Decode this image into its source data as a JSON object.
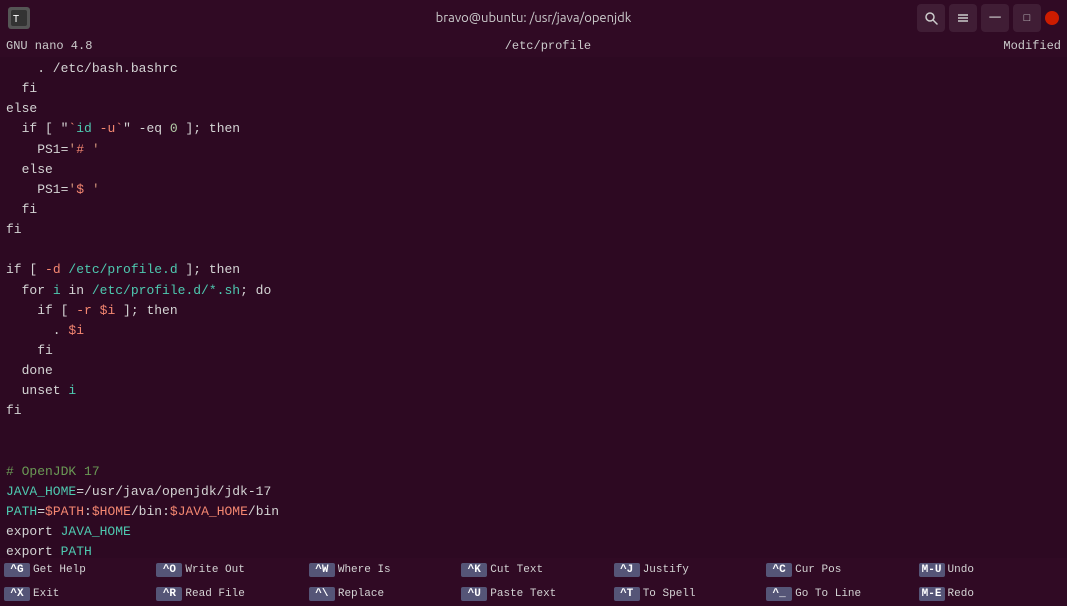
{
  "titlebar": {
    "title": "bravo@ubuntu: /usr/java/openjdk",
    "app_icon": "T"
  },
  "nano": {
    "top_left": "GNU nano 4.8",
    "top_center": "/etc/profile",
    "top_right": "Modified"
  },
  "editor": {
    "lines": [
      {
        "content": "    . /etc/bash.bashrc",
        "type": "mixed"
      },
      {
        "content": "  fi",
        "type": "keyword"
      },
      {
        "content": "else",
        "type": "keyword"
      },
      {
        "content": "  if [ \"`id -u`\" -eq 0 ]; then",
        "type": "mixed"
      },
      {
        "content": "    PS1='# '",
        "type": "mixed"
      },
      {
        "content": "  else",
        "type": "keyword"
      },
      {
        "content": "    PS1='$ '",
        "type": "mixed"
      },
      {
        "content": "  fi",
        "type": "keyword"
      },
      {
        "content": "fi",
        "type": "keyword"
      },
      {
        "content": "",
        "type": "blank"
      },
      {
        "content": "if [ -d /etc/profile.d ]; then",
        "type": "mixed"
      },
      {
        "content": "  for i in /etc/profile.d/*.sh; do",
        "type": "mixed"
      },
      {
        "content": "    if [ -r $i ]; then",
        "type": "mixed"
      },
      {
        "content": "      . $i",
        "type": "mixed"
      },
      {
        "content": "    fi",
        "type": "keyword"
      },
      {
        "content": "  done",
        "type": "keyword"
      },
      {
        "content": "  unset i",
        "type": "mixed"
      },
      {
        "content": "fi",
        "type": "keyword"
      },
      {
        "content": "",
        "type": "blank"
      },
      {
        "content": "",
        "type": "blank"
      },
      {
        "content": "# OpenJDK 17",
        "type": "comment"
      },
      {
        "content": "JAVA_HOME=/usr/java/openjdk/jdk-17",
        "type": "mixed"
      },
      {
        "content": "PATH=$PATH:$HOME/bin:$JAVA_HOME/bin",
        "type": "mixed"
      },
      {
        "content": "export JAVA_HOME",
        "type": "mixed"
      },
      {
        "content": "export PATH",
        "type": "mixed"
      },
      {
        "content": "",
        "type": "cursor"
      }
    ]
  },
  "shortcuts": {
    "row1": [
      {
        "key": "^G",
        "label": "Get Help"
      },
      {
        "key": "^O",
        "label": "Write Out"
      },
      {
        "key": "^W",
        "label": "Where Is"
      },
      {
        "key": "^K",
        "label": "Cut Text"
      },
      {
        "key": "^J",
        "label": "Justify"
      },
      {
        "key": "^C",
        "label": "Cur Pos"
      },
      {
        "key": "M-U",
        "label": "Undo"
      }
    ],
    "row2": [
      {
        "key": "^X",
        "label": "Exit"
      },
      {
        "key": "^R",
        "label": "Read File"
      },
      {
        "key": "^\\",
        "label": "Replace"
      },
      {
        "key": "^U",
        "label": "Paste Text"
      },
      {
        "key": "^T",
        "label": "To Spell"
      },
      {
        "key": "^_",
        "label": "Go To Line"
      },
      {
        "key": "M-E",
        "label": "Redo"
      }
    ]
  }
}
